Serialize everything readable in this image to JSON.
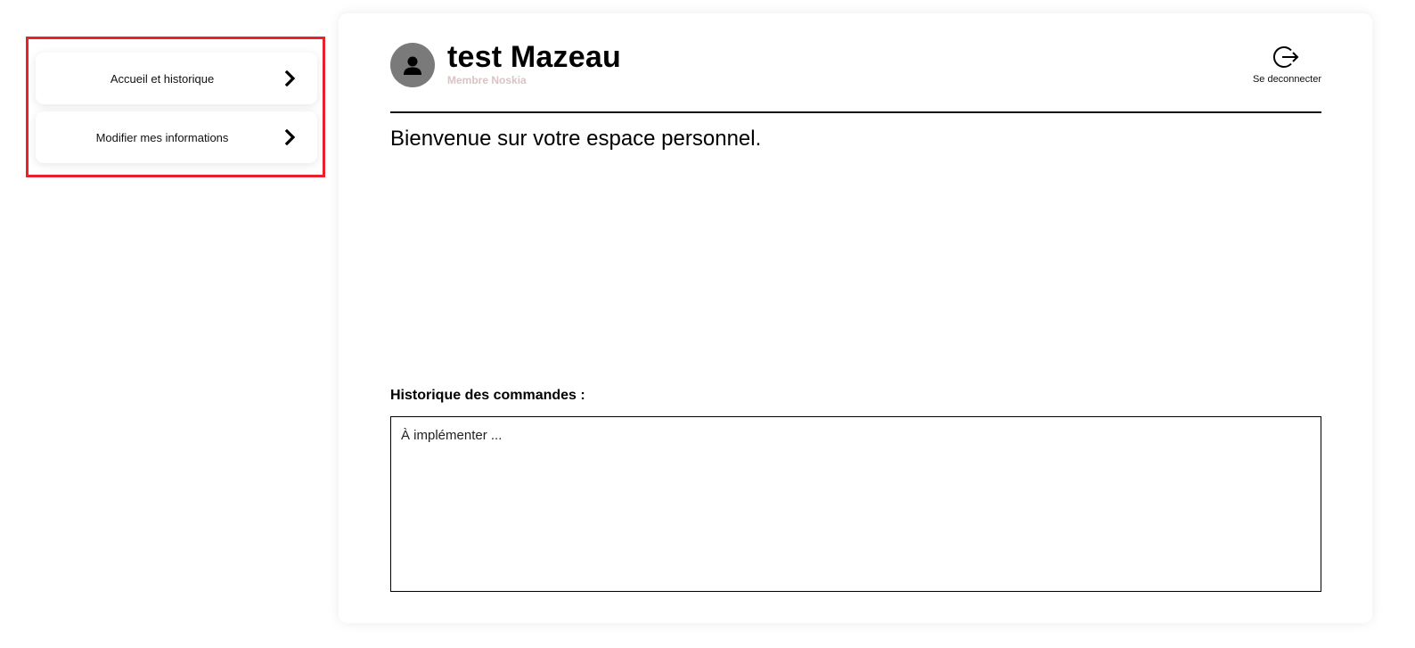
{
  "sidebar": {
    "items": [
      {
        "label": "Accueil et historique",
        "icon": "chevron-right-icon"
      },
      {
        "label": "Modifier mes informations",
        "icon": "chevron-right-icon"
      }
    ],
    "highlight_color": "#e8212b"
  },
  "profile": {
    "name": "test Mazeau",
    "role": "Membre Noskia",
    "avatar_icon": "user-icon"
  },
  "header": {
    "logout_label": "Se deconnecter",
    "logout_icon": "logout-icon"
  },
  "main": {
    "welcome": "Bienvenue sur votre espace personnel.",
    "history_title": "Historique des commandes :",
    "history_placeholder": "À implémenter ..."
  }
}
